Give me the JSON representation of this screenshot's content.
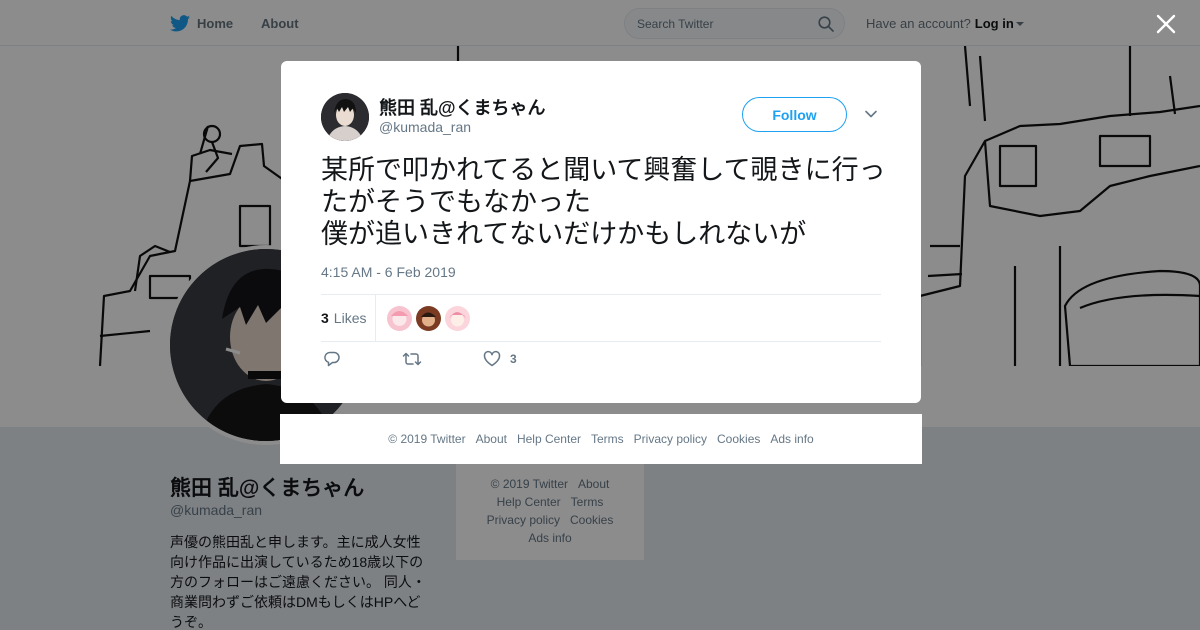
{
  "topbar": {
    "home_label": "Home",
    "about_label": "About",
    "search_placeholder": "Search Twitter",
    "account_prompt": "Have an account?",
    "login_label": "Log in",
    "icons": {
      "brand": "twitter-bird-icon",
      "search": "search-icon",
      "login_menu": "caret-down-icon"
    }
  },
  "profile": {
    "name": "熊田 乱@くまちゃん",
    "handle": "@kumada_ran",
    "bio": "声優の熊田乱と申します。主に成人女性向け作品に出演しているため18歳以下の方のフォローはご遠慮ください。 同人・商業問わずご依頼はDMもしくはHPへどうぞ。"
  },
  "sidebar_footer": {
    "lines": [
      [
        "© 2019 Twitter",
        "About"
      ],
      [
        "Help Center",
        "Terms"
      ],
      [
        "Privacy policy",
        "Cookies"
      ],
      [
        "Ads info"
      ]
    ]
  },
  "tweet": {
    "author_name": "熊田 乱@くまちゃん",
    "author_handle": "@kumada_ran",
    "follow_label": "Follow",
    "text": "某所で叩かれてると聞いて興奮して覗きに行ったがそうでもなかった\n僕が追いきれてないだけかもしれないが",
    "timestamp": "4:15 AM - 6 Feb 2019",
    "likes_count": "3",
    "likes_label": "Likes",
    "like_action_count": "3",
    "icons": {
      "menu": "chevron-down-icon",
      "reply": "reply-icon",
      "retweet": "retweet-icon",
      "like": "heart-icon",
      "close": "close-icon"
    }
  },
  "modal_footer": {
    "items": [
      "© 2019 Twitter",
      "About",
      "Help Center",
      "Terms",
      "Privacy policy",
      "Cookies",
      "Ads info"
    ]
  },
  "colors": {
    "brand": "#1da1f2",
    "text": "#14171a",
    "secondary_text": "#657786",
    "page_background": "#e6ecf0",
    "overlay": "rgba(0,0,0,0.45)"
  }
}
